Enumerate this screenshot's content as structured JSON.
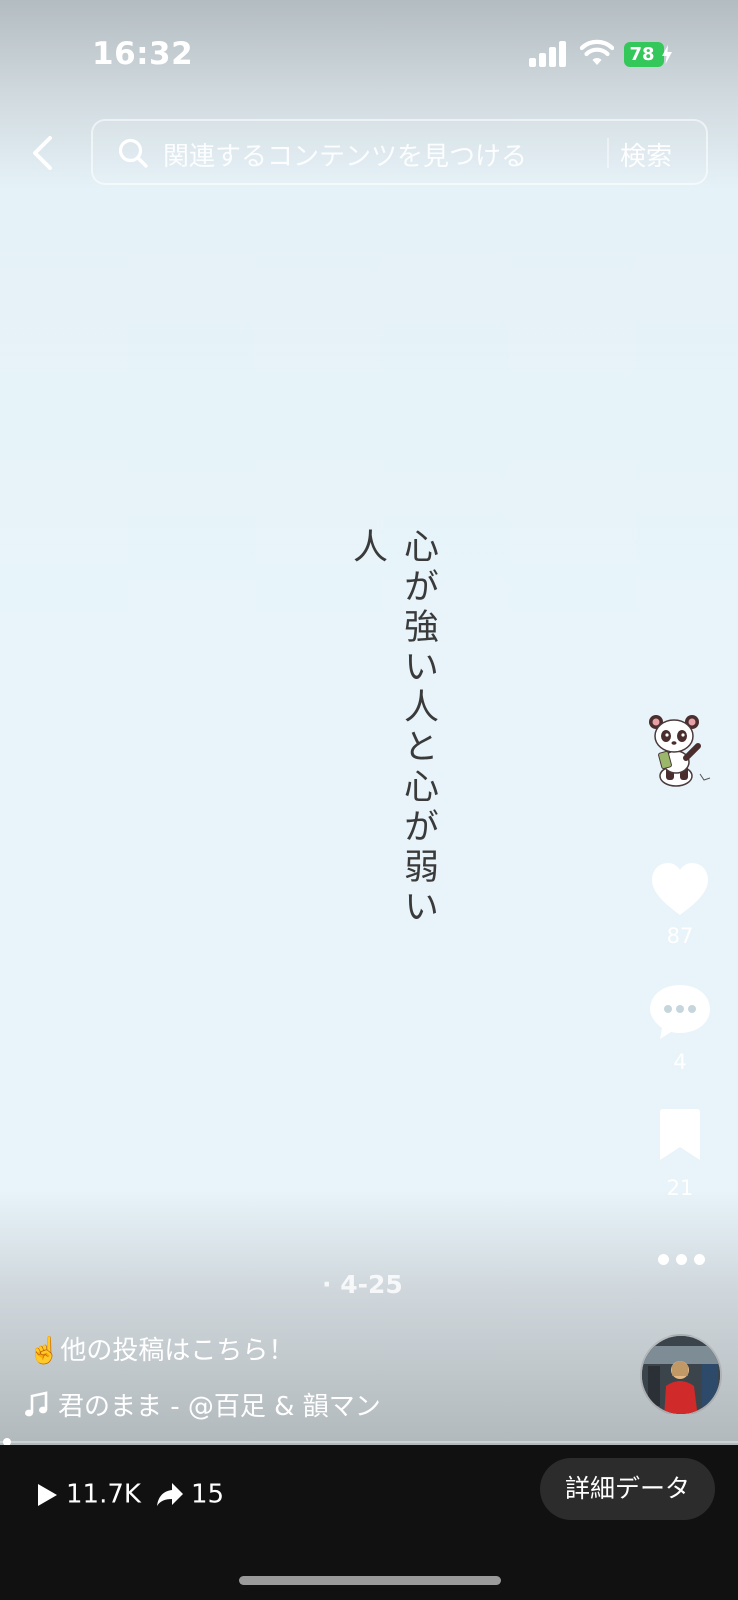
{
  "status_bar": {
    "time": "16:32",
    "battery_percent": "78",
    "battery_charging": true,
    "colors": {
      "battery": "#34c759"
    }
  },
  "search": {
    "placeholder": "関連するコンテンツを見つける",
    "button_label": "検索"
  },
  "video": {
    "title_text": "心が強い人と心が弱い人",
    "date": "· 4-25",
    "progress": 0.01
  },
  "actions": {
    "like_count": "87",
    "comment_count": "4",
    "bookmark_count": "21"
  },
  "post": {
    "caption": "☝️他の投稿はこちら！",
    "music": "君のまま - @百足 & 韻マン"
  },
  "bottom_bar": {
    "plays": "11.7K",
    "shares": "15",
    "details_label": "詳細データ"
  },
  "icons": {
    "back": "chevron-left-icon",
    "search": "search-icon",
    "like": "heart-icon",
    "comment": "comment-icon",
    "bookmark": "bookmark-icon",
    "more": "more-icon",
    "music": "music-note-icon",
    "play": "play-icon",
    "share": "share-icon"
  }
}
